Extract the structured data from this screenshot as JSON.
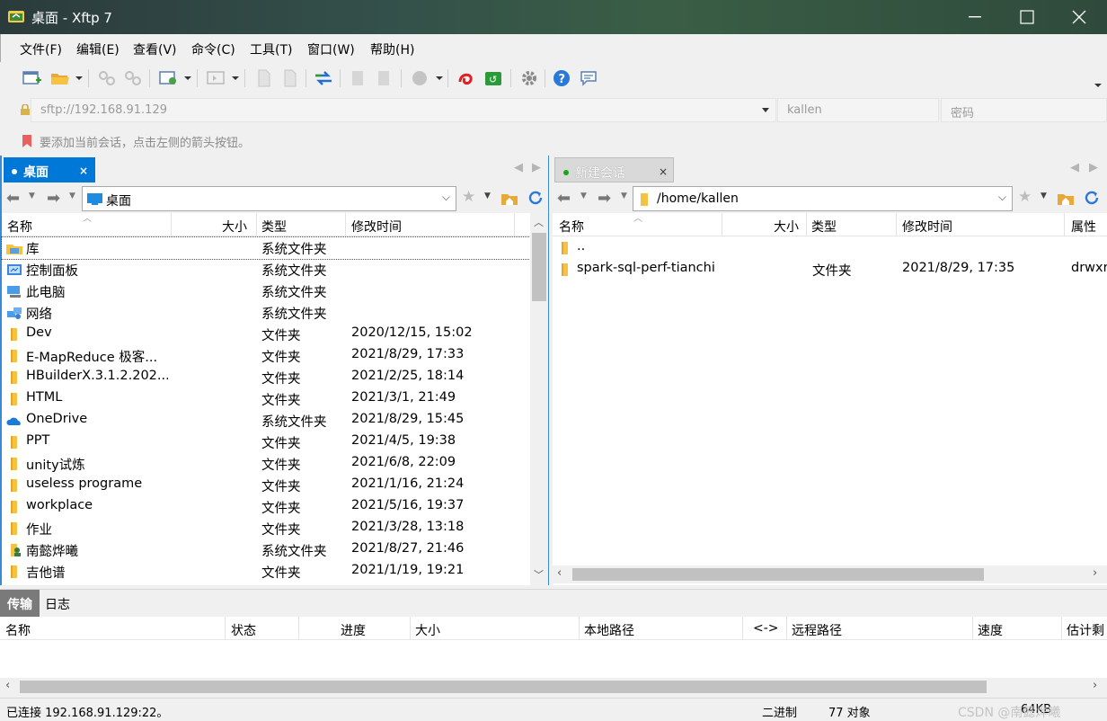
{
  "window": {
    "title": "桌面 - Xftp 7",
    "minimize_glyph": "—",
    "maximize_glyph": "☐",
    "close_glyph": "✕"
  },
  "menu": [
    "文件(F)",
    "编辑(E)",
    "查看(V)",
    "命令(C)",
    "工具(T)",
    "窗口(W)",
    "帮助(H)"
  ],
  "address": {
    "host_placeholder": "sftp://192.168.91.129",
    "user_placeholder": "kallen",
    "password_placeholder": "密码"
  },
  "hint": "要添加当前会话，点击左侧的箭头按钮。",
  "local": {
    "tab_label": "桌面",
    "tab_close": "×",
    "path": "桌面",
    "columns": [
      "名称",
      "大小",
      "类型",
      "修改时间"
    ],
    "rows": [
      {
        "icon": "library-icon",
        "name": "库",
        "size": "",
        "type": "系统文件夹",
        "modified": ""
      },
      {
        "icon": "control-panel-icon",
        "name": "控制面板",
        "size": "",
        "type": "系统文件夹",
        "modified": ""
      },
      {
        "icon": "computer-icon",
        "name": "此电脑",
        "size": "",
        "type": "系统文件夹",
        "modified": ""
      },
      {
        "icon": "network-icon",
        "name": "网络",
        "size": "",
        "type": "系统文件夹",
        "modified": ""
      },
      {
        "icon": "folder-icon",
        "name": "Dev",
        "size": "",
        "type": "文件夹",
        "modified": "2020/12/15, 15:02"
      },
      {
        "icon": "folder-icon",
        "name": "E-MapReduce 极客...",
        "size": "",
        "type": "文件夹",
        "modified": "2021/8/29, 17:33"
      },
      {
        "icon": "folder-icon",
        "name": "HBuilderX.3.1.2.202...",
        "size": "",
        "type": "文件夹",
        "modified": "2021/2/25, 18:14"
      },
      {
        "icon": "folder-icon",
        "name": "HTML",
        "size": "",
        "type": "文件夹",
        "modified": "2021/3/1, 21:49"
      },
      {
        "icon": "onedrive-icon",
        "name": "OneDrive",
        "size": "",
        "type": "系统文件夹",
        "modified": "2021/8/29, 15:45"
      },
      {
        "icon": "folder-icon",
        "name": "PPT",
        "size": "",
        "type": "文件夹",
        "modified": "2021/4/5, 19:38"
      },
      {
        "icon": "folder-icon",
        "name": "unity试炼",
        "size": "",
        "type": "文件夹",
        "modified": "2021/6/8, 22:09"
      },
      {
        "icon": "folder-icon",
        "name": "useless programe",
        "size": "",
        "type": "文件夹",
        "modified": "2021/1/16, 21:24"
      },
      {
        "icon": "folder-icon",
        "name": "workplace",
        "size": "",
        "type": "文件夹",
        "modified": "2021/5/16, 19:37"
      },
      {
        "icon": "folder-icon",
        "name": "作业",
        "size": "",
        "type": "文件夹",
        "modified": "2021/3/28, 13:18"
      },
      {
        "icon": "user-folder-icon",
        "name": "南懿烨曦",
        "size": "",
        "type": "系统文件夹",
        "modified": "2021/8/27, 21:46"
      },
      {
        "icon": "folder-icon",
        "name": "吉他谱",
        "size": "",
        "type": "文件夹",
        "modified": "2021/1/19, 19:21"
      }
    ]
  },
  "remote": {
    "tab_label": "新建会话",
    "tab_close": "×",
    "path": "/home/kallen",
    "columns": [
      "名称",
      "大小",
      "类型",
      "修改时间",
      "属性"
    ],
    "rows": [
      {
        "icon": "folder-icon",
        "name": "..",
        "size": "",
        "type": "",
        "modified": "",
        "attr": ""
      },
      {
        "icon": "folder-icon",
        "name": "spark-sql-perf-tianchi",
        "size": "",
        "type": "文件夹",
        "modified": "2021/8/29, 17:35",
        "attr": "drwxr"
      }
    ]
  },
  "transfer": {
    "tabs": [
      "传输",
      "日志"
    ],
    "columns": [
      "名称",
      "状态",
      "进度",
      "大小",
      "本地路径",
      "<->",
      "远程路径",
      "速度",
      "估计剩"
    ]
  },
  "status": {
    "connection": "已连接 192.168.91.129:22。",
    "mode": "二进制",
    "objects": "77 对象",
    "size": "64KB",
    "watermark": "CSDN @南懿烨曦"
  },
  "colors": {
    "accent": "#0078d7",
    "remote_dot": "#1aa51a",
    "folder": "#f5c242"
  }
}
